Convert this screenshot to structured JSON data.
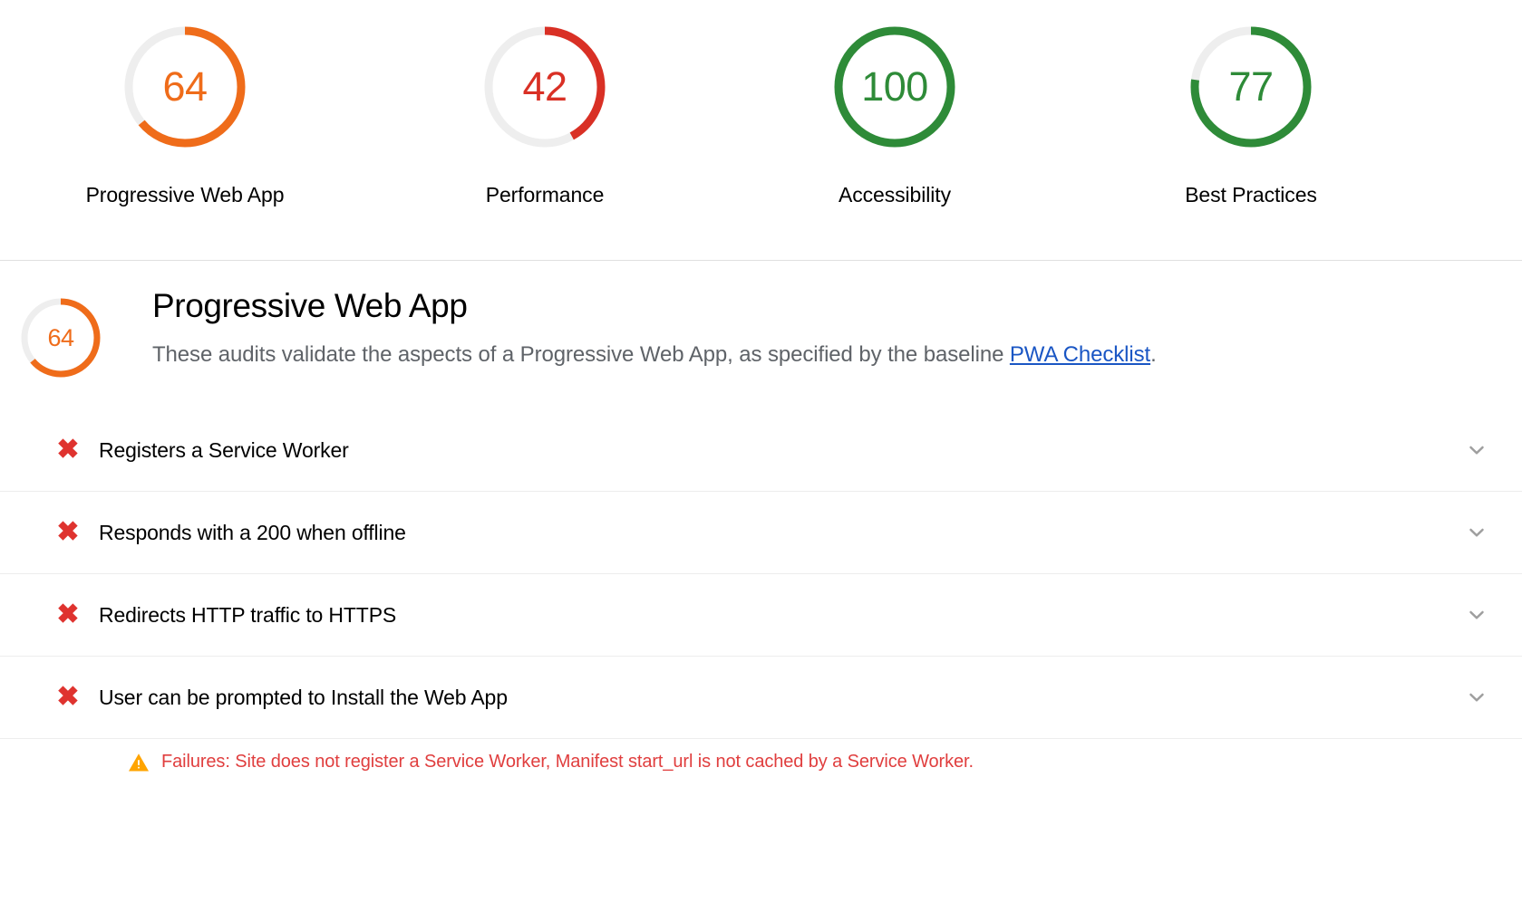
{
  "scores_bar": {
    "categories": [
      {
        "label": "Progressive Web App",
        "score": "64",
        "score_num": 64,
        "color": "#ef6c1a",
        "icon": "gauge-arc"
      },
      {
        "label": "Performance",
        "score": "42",
        "score_num": 42,
        "color": "#d93025",
        "icon": "gauge-arc"
      },
      {
        "label": "Accessibility",
        "score": "100",
        "score_num": 100,
        "color": "#2e8b38",
        "icon": "gauge-arc"
      },
      {
        "label": "Best Practices",
        "score": "77",
        "score_num": 77,
        "color": "#2e8b38",
        "icon": "gauge-arc"
      }
    ]
  },
  "category": {
    "gauge": {
      "score": "64",
      "score_num": 64,
      "color": "#ef6c1a"
    },
    "title": "Progressive Web App",
    "description_before": "These audits validate the aspects of a Progressive Web App, as specified by the baseline ",
    "description_link": "PWA Checklist",
    "description_after": ".",
    "link_color": "#1a56c4"
  },
  "audits": [
    {
      "status_icon": "x-mark-icon",
      "title": "Registers a Service Worker",
      "expand_icon": "chevron-down-icon"
    },
    {
      "status_icon": "x-mark-icon",
      "title": "Responds with a 200 when offline",
      "expand_icon": "chevron-down-icon"
    },
    {
      "status_icon": "x-mark-icon",
      "title": "Redirects HTTP traffic to HTTPS",
      "expand_icon": "chevron-down-icon"
    },
    {
      "status_icon": "x-mark-icon",
      "title": "User can be prompted to Install the Web App",
      "expand_icon": "chevron-down-icon"
    }
  ],
  "failure": {
    "warning_icon": "warning-triangle-icon",
    "text": "Failures: Site does not register a Service Worker, Manifest start_url is not cached by a Service Worker.",
    "text_color": "#e03e3e",
    "icon_color": "#ffa400"
  },
  "glyphs": {
    "x_mark": "✖"
  }
}
